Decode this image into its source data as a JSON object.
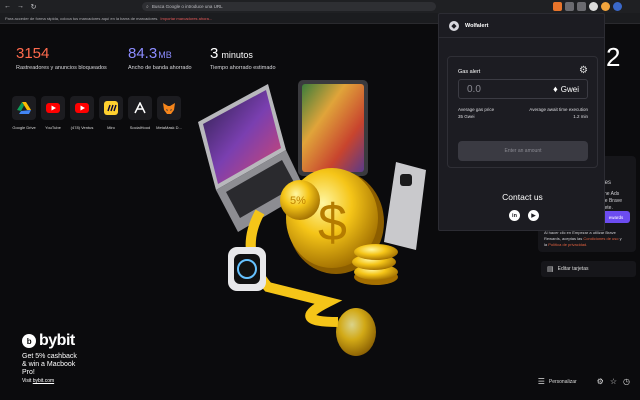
{
  "browser": {
    "omnibox_text": "Busca Google o introduce una URL",
    "bookmarks_bar_text": "Para acceder de forma rápida, coloca tus marcadores aquí en la barra de marcadores.",
    "bookmarks_bar_link": "Importar marcadores ahora..."
  },
  "stats": [
    {
      "value": "3154",
      "unit": "",
      "label": "Rastreadores y anuncios bloqueados",
      "color": "#ff6a4d"
    },
    {
      "value": "84.3",
      "unit": "MB",
      "label": "Ancho de banda ahorrado",
      "color": "#8c8cff"
    },
    {
      "value": "3",
      "unit": "minutos",
      "label": "Tiempo ahorrado estimado",
      "color": "#ffffff"
    }
  ],
  "shortcuts": [
    {
      "label": "Google Drive",
      "icon": "google-drive-icon"
    },
    {
      "label": "YouTube",
      "icon": "youtube-icon"
    },
    {
      "label": "(478) Ventus",
      "icon": "youtube-icon"
    },
    {
      "label": "Miro",
      "icon": "miro-icon"
    },
    {
      "label": "SocialHood",
      "icon": "socialhood-icon"
    },
    {
      "label": "MetaMask D...",
      "icon": "metamask-icon"
    }
  ],
  "sponsor": {
    "brand": "bybit",
    "tagline": "Get 5% cashback & win a Macbook Pro!",
    "link_prefix": "Visit",
    "link": "bybit.com"
  },
  "rewards_card": {
    "line1": "oles",
    "line2": "ne Ads",
    "line3": "de Brave",
    "line4": "sete.",
    "button": "ewards",
    "footer1": "Al hacer clic en Empezar a utilizar Brave",
    "footer2": "Rewards, aceptas las",
    "footer_link1": "Condiciones de uso",
    "footer3": "y",
    "footer4": "la",
    "footer_link2": "Política de privacidad."
  },
  "edit_cards_label": "Editar tarjetas",
  "clock_partial": "2",
  "customize_label": "Personalizar",
  "popup": {
    "title": "Wolfalert",
    "gas_alert_label": "Gas alert",
    "gas_input_placeholder": "0.0",
    "gas_unit": "Gwei",
    "avg_gas_label": "Average gas price",
    "avg_gas_value": "35 Gwei",
    "wait_label": "Average await time execution",
    "wait_value": "1.2 min",
    "submit_label": "Enter an amount",
    "contact_label": "Contact us"
  }
}
